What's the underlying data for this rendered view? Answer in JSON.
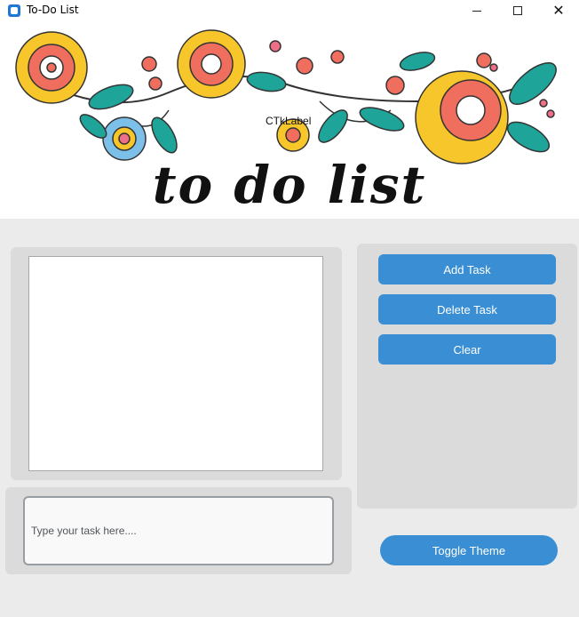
{
  "window": {
    "title": "To-Do List",
    "app_icon": "app-icon",
    "controls": {
      "minimize_icon": "minimize-icon",
      "maximize_icon": "maximize-icon",
      "close_glyph": "✕"
    }
  },
  "banner": {
    "label": "CTkLabel",
    "title": "to do list",
    "colors": {
      "teal": "#1fa49a",
      "coral": "#f06e5e",
      "yellow": "#f7c62b",
      "blue": "#7cc0ea",
      "pink": "#ee6f86",
      "outline": "#333333"
    }
  },
  "task_list": {
    "items": []
  },
  "task_input": {
    "value": "",
    "placeholder": "Type your task here...."
  },
  "buttons": {
    "add": "Add Task",
    "delete": "Delete Task",
    "clear": "Clear",
    "toggle_theme": "Toggle Theme"
  },
  "colors": {
    "accent": "#3a8ed3",
    "frame": "#dbdbdb",
    "background": "#ebebeb"
  }
}
